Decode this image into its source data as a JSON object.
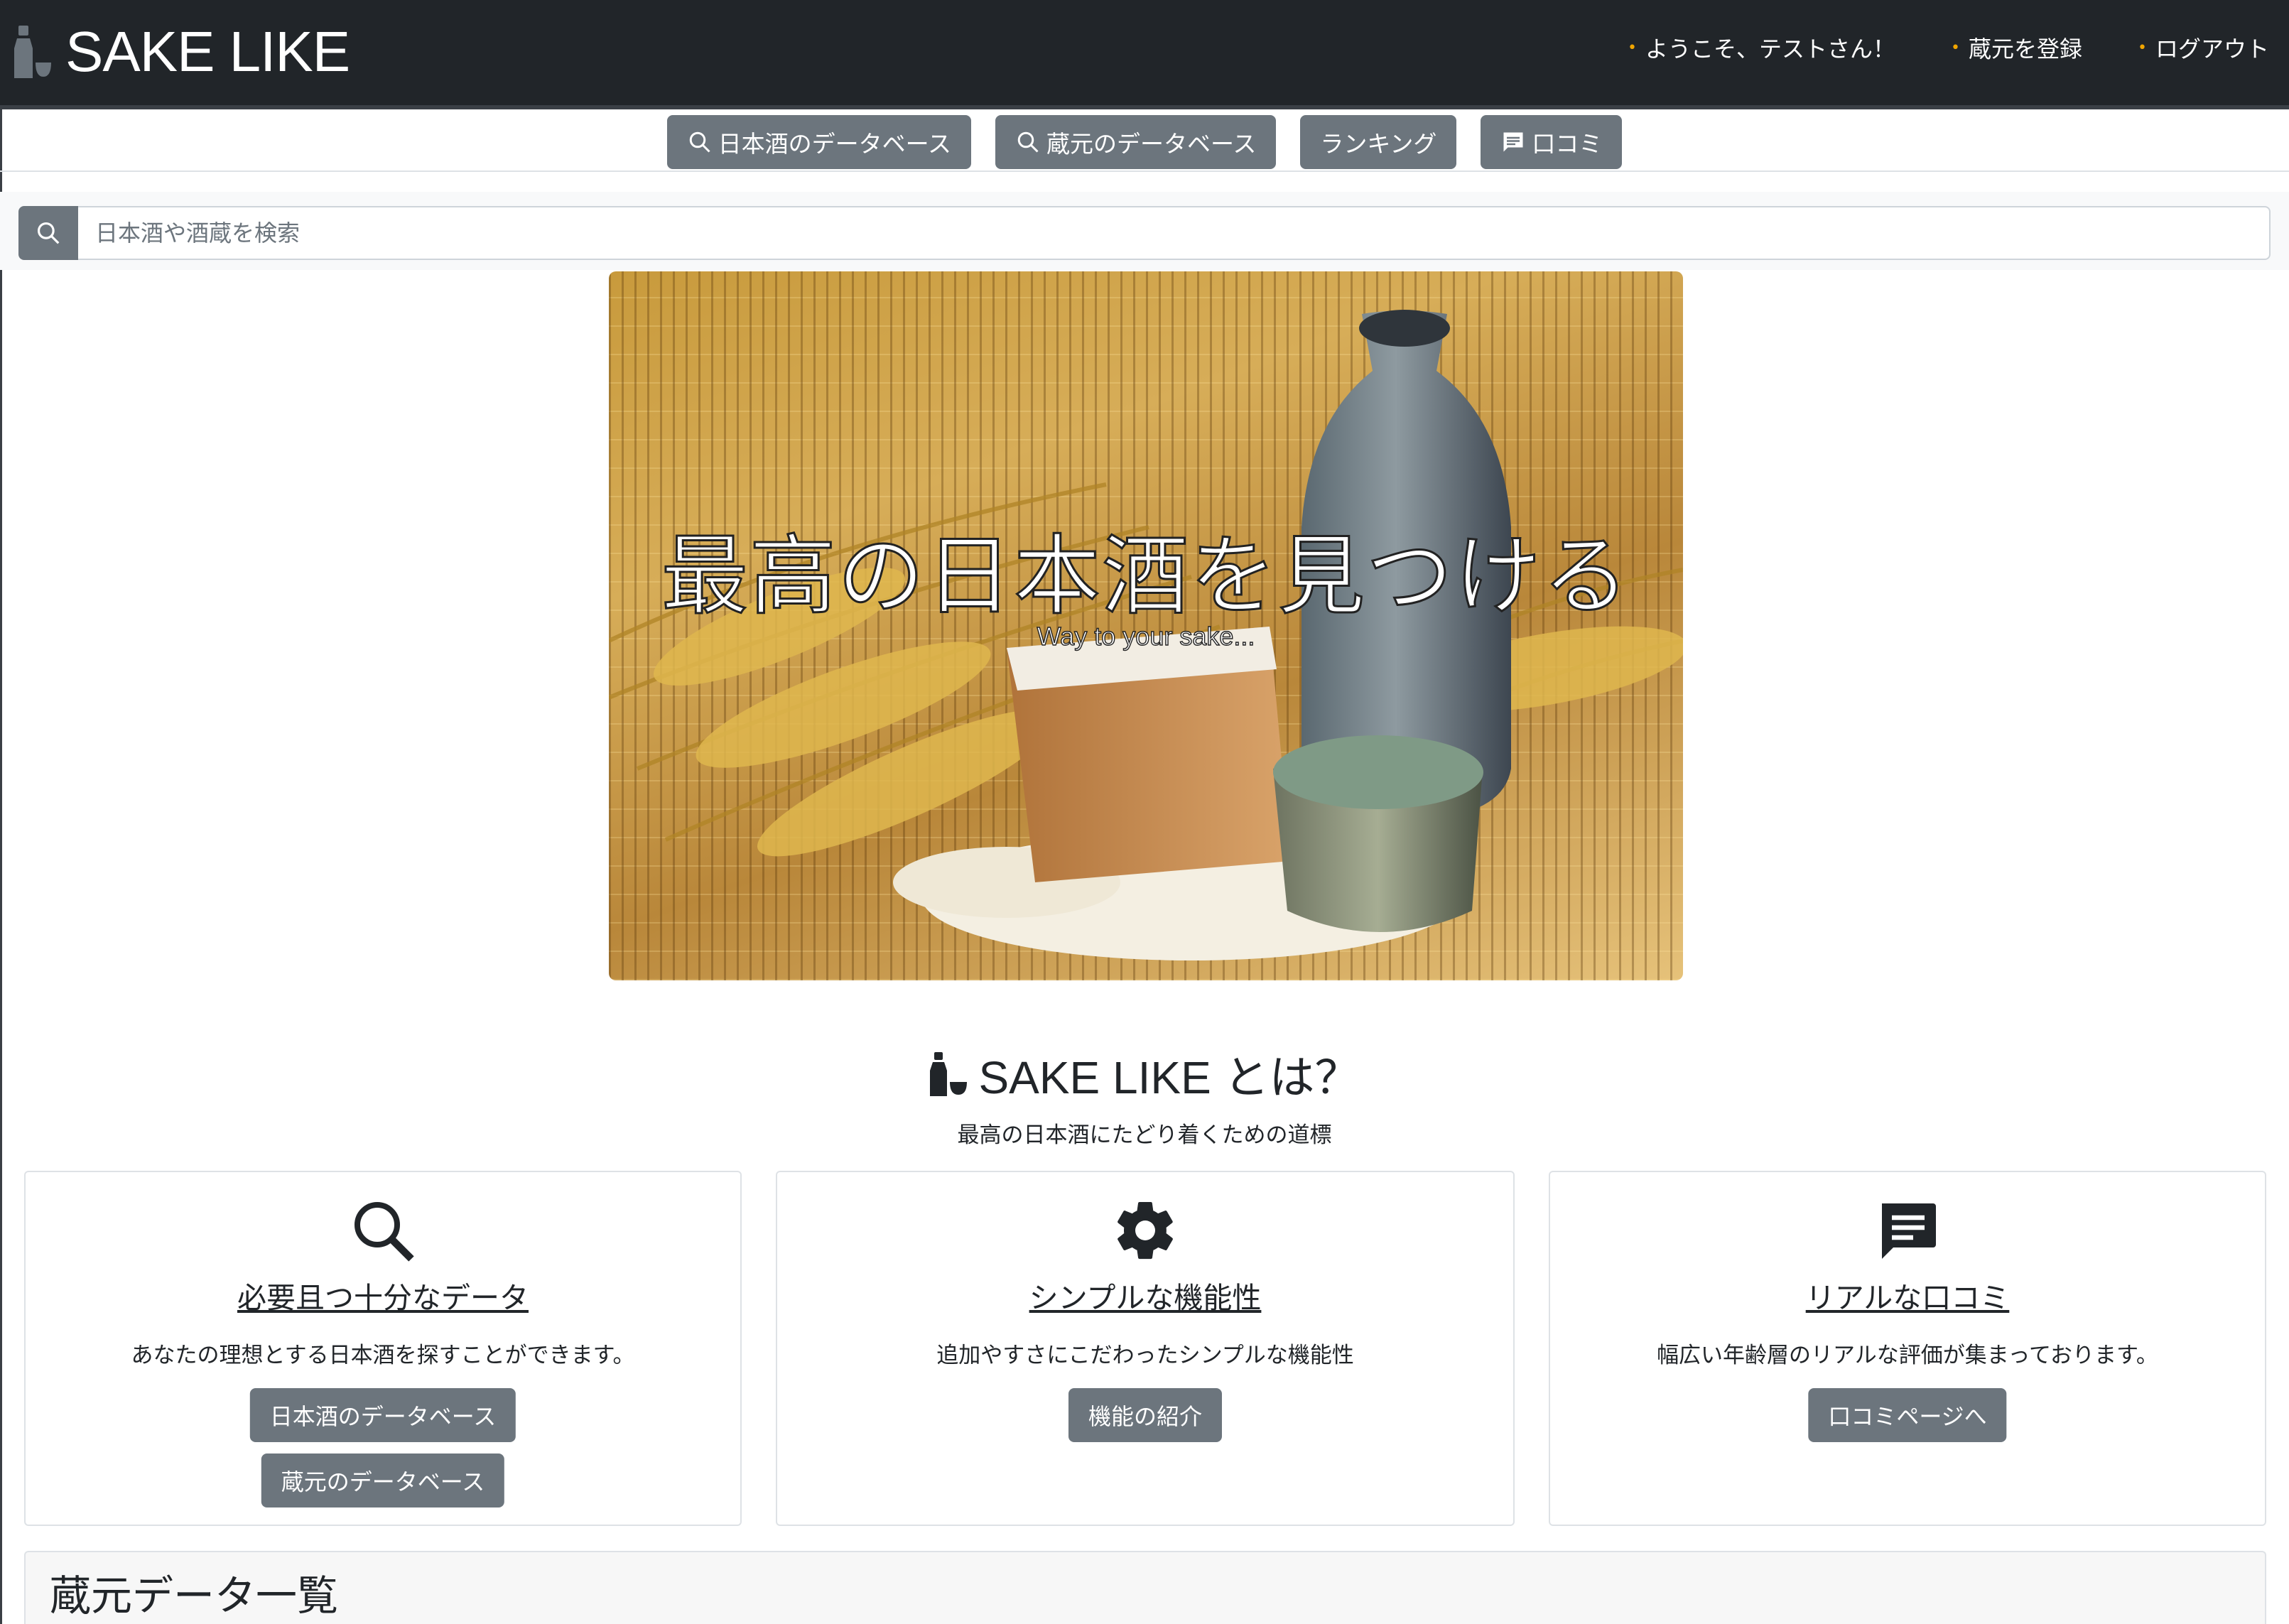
{
  "header": {
    "brand": "SAKE LIKE",
    "nav": [
      {
        "label": "ようこそ、テストさん！"
      },
      {
        "label": "蔵元を登録"
      },
      {
        "label": "ログアウト"
      }
    ]
  },
  "categories": [
    {
      "label": "日本酒のデータベース",
      "icon": "search-icon"
    },
    {
      "label": "蔵元のデータベース",
      "icon": "search-icon"
    },
    {
      "label": "ランキング",
      "icon": ""
    },
    {
      "label": "口コミ",
      "icon": "comment-icon"
    }
  ],
  "search": {
    "placeholder": "日本酒や酒蔵を検索",
    "value": ""
  },
  "hero": {
    "title": "最高の日本酒を見つける",
    "subtitle": "Way to your sake..."
  },
  "about": {
    "title_brand": "SAKE LIKE",
    "title_suffix": "とは？",
    "subtitle": "最高の日本酒にたどり着くための道標"
  },
  "cards": [
    {
      "icon": "search-icon",
      "title": "必要且つ十分なデータ",
      "text": "あなたの理想とする日本酒を探すことができます。",
      "buttons": [
        "日本酒のデータベース",
        "蔵元のデータベース"
      ]
    },
    {
      "icon": "gear-icon",
      "title": "シンプルな機能性",
      "text": "追加やすさにこだわったシンプルな機能性",
      "buttons": [
        "機能の紹介"
      ]
    },
    {
      "icon": "comment-icon",
      "title": "リアルな口コミ",
      "text": "幅広い年齢層のリアルな評価が集まっております。",
      "buttons": [
        "口コミページへ"
      ]
    }
  ],
  "list": {
    "title": "蔵元データ一覧"
  },
  "colors": {
    "navbar": "#212529",
    "button": "#6c757d",
    "accent_dot": "#f0a500"
  }
}
